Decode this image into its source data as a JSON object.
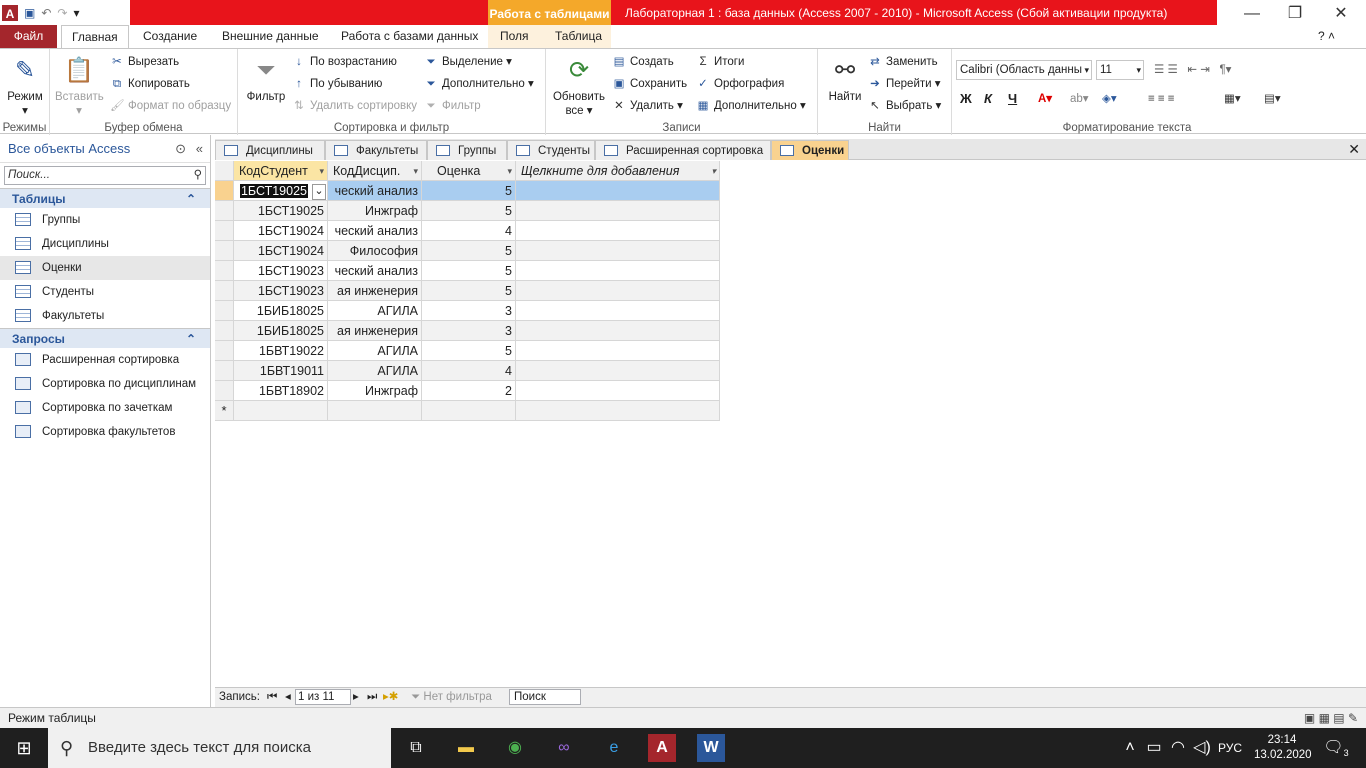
{
  "window": {
    "title": "Лабораторная 1 : база данных (Access 2007 - 2010)  -  Microsoft Access (Сбой активации продукта)",
    "context_tab_group": "Работа с таблицами",
    "app_logo": "A"
  },
  "ribbon_tabs": [
    "Файл",
    "Главная",
    "Создание",
    "Внешние данные",
    "Работа с базами данных",
    "Поля",
    "Таблица"
  ],
  "ribbon": {
    "views": {
      "mode": "Режим",
      "group": "Режимы"
    },
    "clipboard": {
      "paste": "Вставить",
      "cut": "Вырезать",
      "copy": "Копировать",
      "format_painter": "Формат по образцу",
      "group": "Буфер обмена"
    },
    "sort_filter": {
      "filter": "Фильтр",
      "asc": "По возрастанию",
      "desc": "По убыванию",
      "remove_sort": "Удалить сортировку",
      "selection": "Выделение",
      "advanced": "Дополнительно",
      "toggle_filter": "Фильтр",
      "group": "Сортировка и фильтр"
    },
    "records": {
      "refresh": "Обновить",
      "refresh2": "все",
      "new": "Создать",
      "save": "Сохранить",
      "delete": "Удалить",
      "totals": "Итоги",
      "spelling": "Орфография",
      "more": "Дополнительно",
      "group": "Записи"
    },
    "find": {
      "find": "Найти",
      "replace": "Заменить",
      "goto": "Перейти",
      "select": "Выбрать",
      "group": "Найти"
    },
    "text_format": {
      "font": "Calibri (Область данны",
      "size": "11",
      "bold": "Ж",
      "italic": "К",
      "underline": "Ч",
      "group": "Форматирование текста"
    }
  },
  "nav": {
    "header": "Все объекты Access",
    "search_placeholder": "Поиск...",
    "tables_header": "Таблицы",
    "tables": [
      "Группы",
      "Дисциплины",
      "Оценки",
      "Студенты",
      "Факультеты"
    ],
    "queries_header": "Запросы",
    "queries": [
      "Расширенная сортировка",
      "Сортировка по дисциплинам",
      "Сортировка по зачеткам",
      "Сортировка факультетов"
    ]
  },
  "doc_tabs": [
    "Дисциплины",
    "Факультеты",
    "Группы",
    "Студенты",
    "Расширенная сортировка",
    "Оценки"
  ],
  "table": {
    "columns": [
      "КодСтудент",
      "КодДисцип.",
      "Оценка",
      "Щелкните для добавления"
    ],
    "rows": [
      [
        "1БСТ19025",
        "ческий анализ",
        "5"
      ],
      [
        "1БСТ19025",
        "Инжграф",
        "5"
      ],
      [
        "1БСТ19024",
        "ческий анализ",
        "4"
      ],
      [
        "1БСТ19024",
        "Философия",
        "5"
      ],
      [
        "1БСТ19023",
        "ческий анализ",
        "5"
      ],
      [
        "1БСТ19023",
        "ая инженерия",
        "5"
      ],
      [
        "1БИБ18025",
        "АГИЛА",
        "3"
      ],
      [
        "1БИБ18025",
        "ая инженерия",
        "3"
      ],
      [
        "1БВТ19022",
        "АГИЛА",
        "5"
      ],
      [
        "1БВТ19011",
        "АГИЛА",
        "4"
      ],
      [
        "1БВТ18902",
        "Инжграф",
        "2"
      ]
    ],
    "new_row_marker": "*"
  },
  "record_nav": {
    "label": "Запись:",
    "position": "1 из 11",
    "no_filter": "Нет фильтра",
    "search": "Поиск"
  },
  "status": {
    "mode": "Режим таблицы"
  },
  "taskbar": {
    "search_placeholder": "Введите здесь текст для поиска",
    "lang": "РУС",
    "time": "23:14",
    "date": "13.02.2020",
    "notifications": "3"
  },
  "colors": {
    "title_bar": "#e8141b",
    "context_tab": "#f4a82a",
    "file_tab": "#a4262c",
    "selected_row": "#a9cdf0",
    "active_doc_tab": "#f9d28f"
  }
}
